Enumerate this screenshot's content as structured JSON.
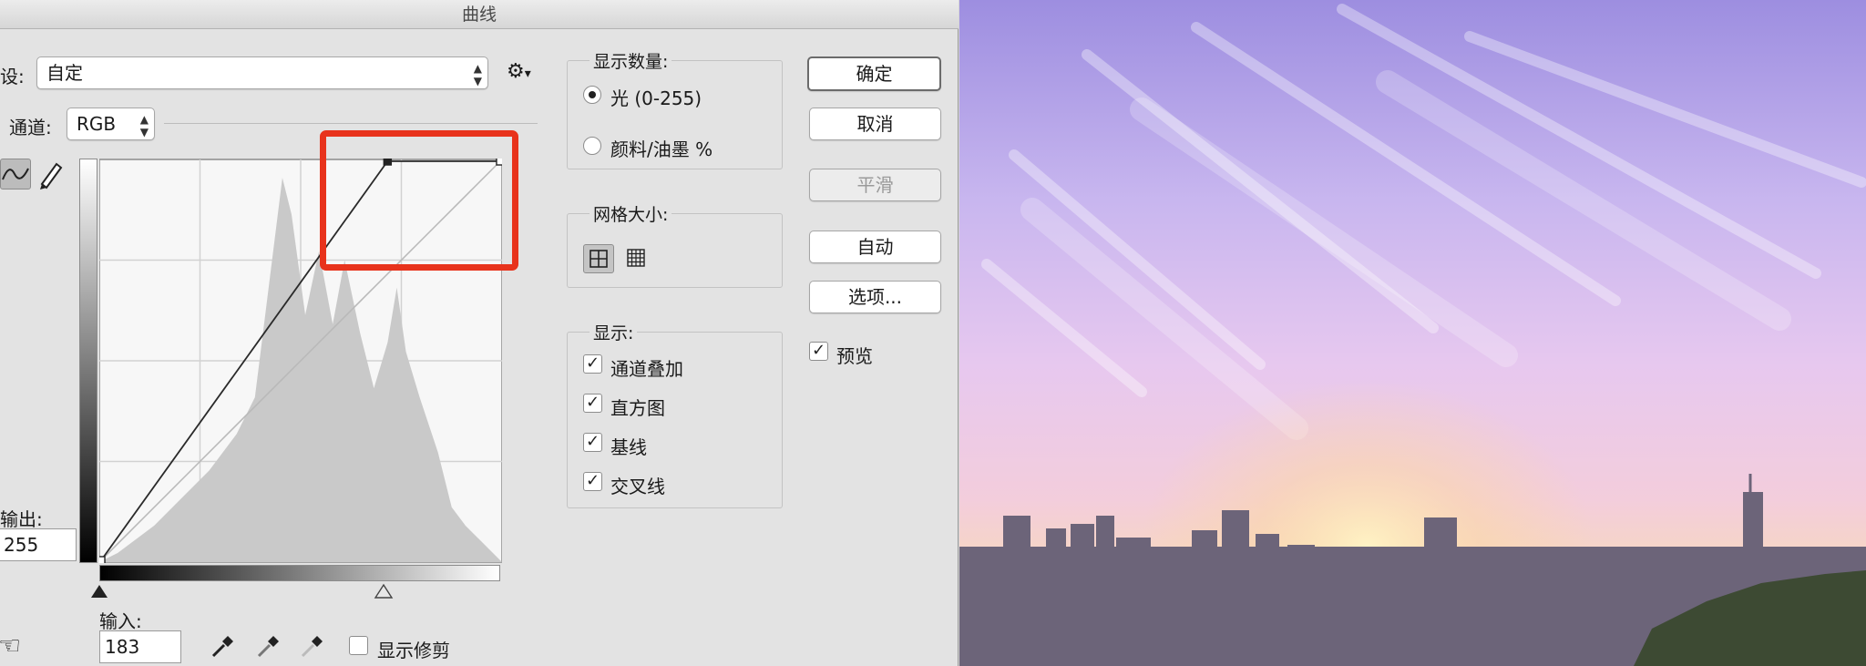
{
  "window": {
    "title": "曲线"
  },
  "preset": {
    "label": "设:",
    "value": "自定",
    "gear_icon": "gear-icon"
  },
  "channel": {
    "label": "通道:",
    "value": "RGB"
  },
  "curve_tools": {
    "point_tool_icon": "curve-point-icon",
    "pencil_icon": "pencil-icon"
  },
  "output": {
    "label": "输出:",
    "value": "255"
  },
  "input": {
    "label": "输入:",
    "value": "183"
  },
  "eyedroppers": [
    "black-eyedropper-icon",
    "gray-eyedropper-icon",
    "white-eyedropper-icon"
  ],
  "show_clipping": {
    "label": "显示修剪",
    "checked": false
  },
  "display_amount": {
    "title": "显示数量:",
    "options": [
      {
        "label": "光 (0-255)",
        "selected": true
      },
      {
        "label": "颜料/油墨 %",
        "selected": false
      }
    ]
  },
  "grid_size": {
    "title": "网格大小:",
    "simple_icon": "grid-simple-icon",
    "detailed_icon": "grid-detailed-icon"
  },
  "show": {
    "title": "显示:",
    "options": [
      {
        "label": "通道叠加",
        "checked": true
      },
      {
        "label": "直方图",
        "checked": true
      },
      {
        "label": "基线",
        "checked": true
      },
      {
        "label": "交叉线",
        "checked": true
      }
    ]
  },
  "buttons": {
    "ok": "确定",
    "cancel": "取消",
    "smooth": "平滑",
    "auto": "自动",
    "options": "选项..."
  },
  "preview": {
    "label": "预览",
    "checked": true
  },
  "curve": {
    "input_min": 0,
    "input_max": 255,
    "points": [
      [
        0,
        0
      ],
      [
        183,
        255
      ],
      [
        255,
        255
      ]
    ]
  },
  "highlight_color": "#e8331c"
}
